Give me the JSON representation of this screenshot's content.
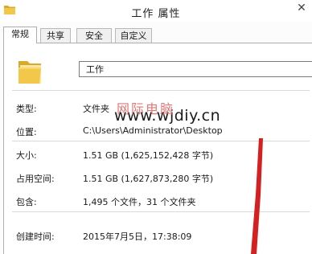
{
  "window": {
    "title": "工作 属性",
    "close_glyph": "✕"
  },
  "tabs": [
    {
      "label": "常规",
      "active": true
    },
    {
      "label": "共享",
      "active": false
    },
    {
      "label": "安全",
      "active": false
    },
    {
      "label": "自定义",
      "active": false
    }
  ],
  "general": {
    "folder_name": "工作",
    "watermark_url": "www.wjdiy.cn",
    "watermark_brand": "网际电脑",
    "fields": {
      "type": {
        "label": "类型:",
        "value": "文件夹"
      },
      "location": {
        "label": "位置:",
        "value": "C:\\Users\\Administrator\\Desktop"
      },
      "size": {
        "label": "大小:",
        "value": "1.51 GB (1,625,152,428 字节)"
      },
      "size_on_disk": {
        "label": "占用空间:",
        "value": "1.51 GB (1,627,873,280 字节)"
      },
      "contains": {
        "label": "包含:",
        "value": "1,495 个文件，31 个文件夹"
      },
      "created": {
        "label": "创建时间:",
        "value": "2015年7月5日，17:38:09"
      }
    }
  },
  "icons": {
    "title_icon": "folder-icon",
    "close": "close-icon",
    "main_icon": "folder-icon",
    "annotation": "red-arrow-annotation"
  },
  "colors": {
    "folder_yellow": "#f3c84a",
    "folder_dark": "#dba92a",
    "arrow_red": "#d42020",
    "watermark_pink": "#e07878"
  }
}
